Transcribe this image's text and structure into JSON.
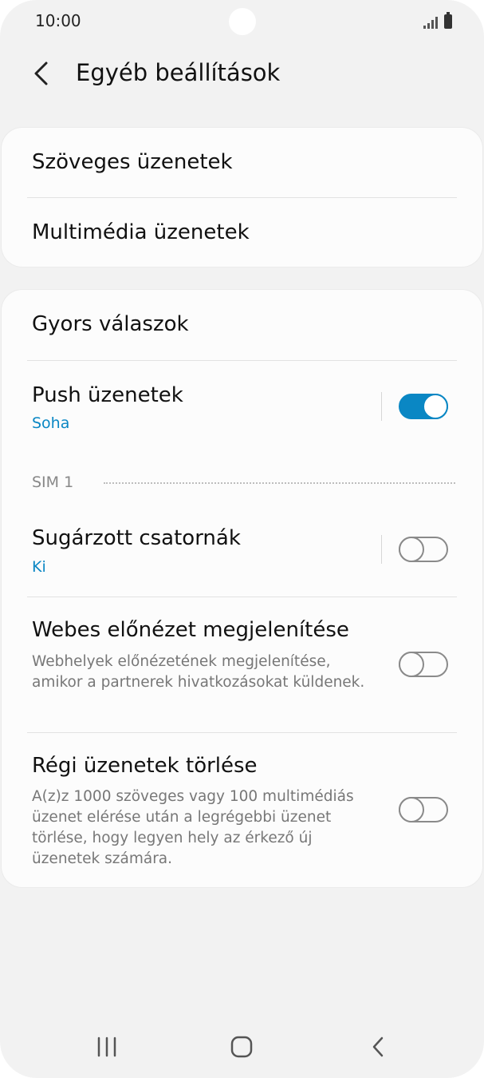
{
  "status_bar": {
    "time": "10:00"
  },
  "header": {
    "title": "Egyéb beállítások",
    "back_icon": "chevron-left-icon"
  },
  "group1": {
    "items": [
      {
        "title": "Szöveges üzenetek"
      },
      {
        "title": "Multimédia üzenetek"
      }
    ]
  },
  "group2": {
    "quick_replies": {
      "title": "Gyors válaszok"
    },
    "push": {
      "title": "Push üzenetek",
      "subtitle": "Soha",
      "enabled": true
    },
    "sim_header": "SIM 1",
    "broadcast": {
      "title": "Sugárzott csatornák",
      "subtitle": "Ki",
      "enabled": false
    },
    "web_preview": {
      "title": "Webes előnézet megjelenítése",
      "description": "Webhelyek előnézetének megjelenítése, amikor a partnerek hivatkozásokat küldenek.",
      "enabled": false
    },
    "delete_old": {
      "title": "Régi üzenetek törlése",
      "description": "A(z)z 1000 szöveges vagy 100 multimédiás üzenet elérése után a legrégebbi üzenet törlése, hogy legyen hely az érkező új üzenetek számára.",
      "enabled": false
    }
  },
  "colors": {
    "accent": "#0a87c4",
    "background": "#f2f2f2",
    "card": "#fcfcfc"
  },
  "nav_bar": {
    "recents_icon": "recents-icon",
    "home_icon": "home-icon",
    "back_icon": "back-icon"
  }
}
